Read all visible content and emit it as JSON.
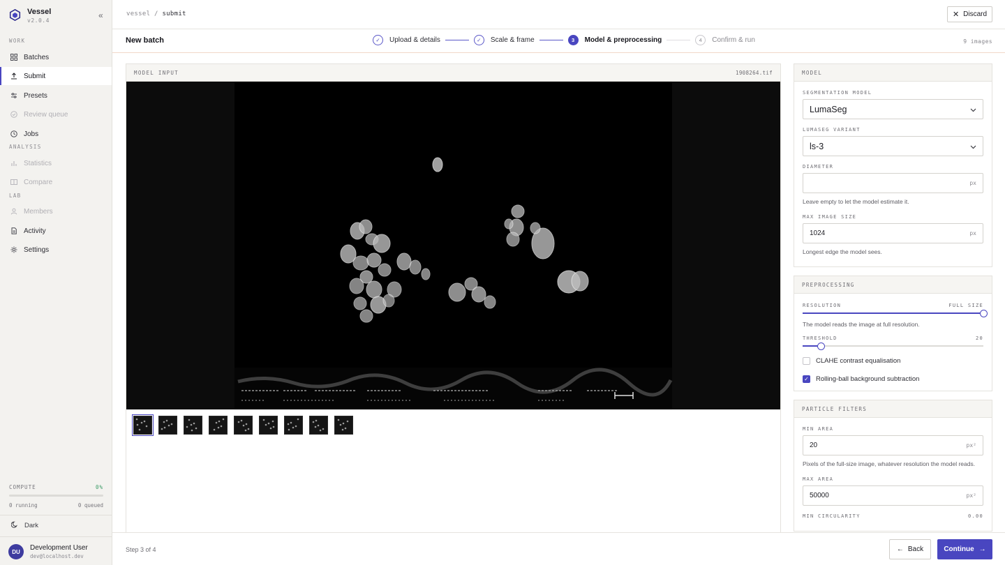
{
  "app": {
    "name": "Vessel",
    "version": "v2.0.4"
  },
  "sidebar": {
    "sections": [
      {
        "label": "WORK",
        "items": [
          {
            "label": "Batches",
            "icon": "grid-icon",
            "state": "normal"
          },
          {
            "label": "Submit",
            "icon": "upload-icon",
            "state": "active"
          },
          {
            "label": "Presets",
            "icon": "sliders-icon",
            "state": "normal"
          },
          {
            "label": "Review queue",
            "icon": "check-circle-icon",
            "state": "disabled"
          },
          {
            "label": "Jobs",
            "icon": "clock-icon",
            "state": "normal"
          }
        ]
      },
      {
        "label": "ANALYSIS",
        "items": [
          {
            "label": "Statistics",
            "icon": "bar-chart-icon",
            "state": "disabled"
          },
          {
            "label": "Compare",
            "icon": "columns-icon",
            "state": "disabled"
          }
        ]
      },
      {
        "label": "LAB",
        "items": [
          {
            "label": "Members",
            "icon": "user-icon",
            "state": "disabled"
          },
          {
            "label": "Activity",
            "icon": "document-icon",
            "state": "normal"
          },
          {
            "label": "Settings",
            "icon": "gear-icon",
            "state": "normal"
          }
        ]
      }
    ],
    "compute": {
      "label": "COMPUTE",
      "percent": "0%",
      "running": "0 running",
      "queued": "0 queued",
      "level": 0
    },
    "theme_label": "Dark",
    "user": {
      "initials": "DU",
      "name": "Development User",
      "email": "dev@localhost.dev"
    }
  },
  "topbar": {
    "crumb_root": "vessel",
    "crumb_sep": "/",
    "crumb_current": "submit",
    "discard_label": "Discard"
  },
  "stepbar": {
    "title": "New batch",
    "steps": [
      {
        "num": "✓",
        "label": "Upload & details",
        "state": "done"
      },
      {
        "num": "✓",
        "label": "Scale & frame",
        "state": "done"
      },
      {
        "num": "3",
        "label": "Model & preprocessing",
        "state": "current"
      },
      {
        "num": "4",
        "label": "Confirm & run",
        "state": "todo"
      }
    ],
    "image_count": "9 images"
  },
  "viewer": {
    "header": "MODEL INPUT",
    "filename": "1908264.tif",
    "thumbnail_count": 9,
    "selected_thumbnail": 0
  },
  "model": {
    "header": "MODEL",
    "segmentation_label": "SEGMENTATION MODEL",
    "segmentation_value": "LumaSeg",
    "variant_label": "LUMASEG VARIANT",
    "variant_value": "ls-3",
    "diameter_label": "DIAMETER",
    "diameter_value": "",
    "diameter_unit": "px",
    "diameter_hint": "Leave empty to let the model estimate it.",
    "max_size_label": "MAX IMAGE SIZE",
    "max_size_value": "1024",
    "max_size_unit": "px",
    "max_size_hint": "Longest edge the model sees."
  },
  "preprocessing": {
    "header": "PREPROCESSING",
    "resolution_label": "RESOLUTION",
    "resolution_value": "FULL SIZE",
    "resolution_level": 1.0,
    "resolution_hint": "The model reads the image at full resolution.",
    "threshold_label": "THRESHOLD",
    "threshold_value": "20",
    "threshold_level": 0.1,
    "clahe_label": "CLAHE contrast equalisation",
    "clahe_checked": false,
    "rolling_label": "Rolling-ball background subtraction",
    "rolling_checked": true
  },
  "filters": {
    "header": "PARTICLE FILTERS",
    "min_area_label": "MIN AREA",
    "min_area_value": "20",
    "min_area_unit": "px²",
    "min_area_hint": "Pixels of the full-size image, whatever resolution the model reads.",
    "max_area_label": "MAX AREA",
    "max_area_value": "50000",
    "max_area_unit": "px²",
    "min_circ_label": "MIN CIRCULARITY",
    "min_circ_value": "0.00"
  },
  "footer": {
    "step_of": "Step 3 of 4",
    "back_label": "Back",
    "continue_label": "Continue"
  }
}
